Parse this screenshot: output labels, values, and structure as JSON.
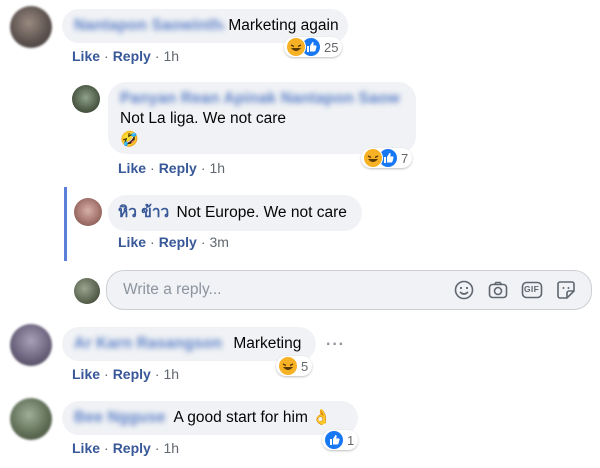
{
  "comments": [
    {
      "author": "Nantapon Saowinthai",
      "text": "Marketing again",
      "actions": {
        "like": "Like",
        "reply": "Reply",
        "time": "1h"
      },
      "reaction_count": "25"
    },
    {
      "author": "Panyan Rean Apinak Nantapon Saowintha",
      "text": "Not La liga. We not care",
      "emoji": "🤣",
      "actions": {
        "like": "Like",
        "reply": "Reply",
        "time": "1h"
      },
      "reaction_count": "7"
    },
    {
      "author": "หิว ข้าว",
      "text": "Not Europe. We not care",
      "actions": {
        "like": "Like",
        "reply": "Reply",
        "time": "3m"
      }
    },
    {
      "author": "Ar Karn Rasangson",
      "text": "Marketing",
      "actions": {
        "like": "Like",
        "reply": "Reply",
        "time": "1h"
      },
      "reaction_count": "5"
    },
    {
      "author": "Bee Ngguse",
      "text": "A good start for him",
      "emoji": "👌",
      "actions": {
        "like": "Like",
        "reply": "Reply",
        "time": "1h"
      },
      "reaction_count": "1"
    }
  ],
  "reply_box": {
    "placeholder": "Write a reply...",
    "tools": [
      "smiley-icon",
      "camera-icon",
      "gif-icon",
      "sticker-icon"
    ],
    "gif_label": "GIF"
  },
  "colors": {
    "link": "#385898",
    "bubble": "#f0f2f5",
    "thread_line": "#5b7fd8",
    "like_blue": "#1877f2",
    "haha_yellow": "#f7b125"
  }
}
